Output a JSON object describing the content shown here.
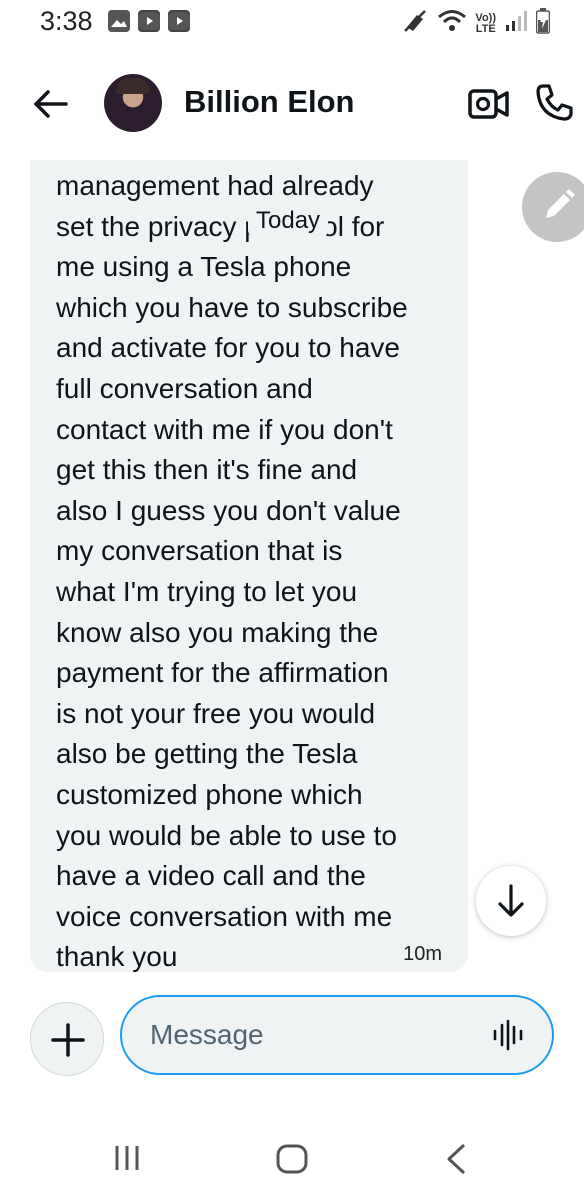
{
  "status_bar": {
    "time": "3:38",
    "left_icons": [
      "gallery-icon",
      "youtube-icon",
      "youtube-icon"
    ],
    "right_icons": [
      "no-sound-icon",
      "wifi-icon",
      "volte-icon",
      "signal-icon",
      "battery-icon"
    ],
    "volte_top": "Vo))",
    "volte_bottom": "LTE"
  },
  "header": {
    "back_icon": "arrow-left-icon",
    "contact_name": "Billion Elon",
    "video_icon": "video-camera-icon",
    "call_icon": "phone-icon"
  },
  "conversation": {
    "date_divider": "Today",
    "message": {
      "text": "management had already\nset the privacy protocol for\nme using a Tesla phone\nwhich you have to subscribe\nand activate for you to have\nfull conversation and\ncontact with me if you don't\nget this then it's fine and\nalso I guess you don't value\nmy conversation that is\nwhat I'm trying to let you\nknow also you making the\npayment for the affirmation\nis not your free you would\nalso be getting the Tesla\ncustomized phone which\nyou would be able to use to\nhave a video call and the\nvoice conversation with me\nthank you",
      "time": "10m"
    }
  },
  "composer": {
    "placeholder": "Message",
    "add_icon": "plus-icon",
    "voice_icon": "voice-waveform-icon"
  },
  "fabs": {
    "edit_icon": "pencil-icon",
    "scroll_icon": "arrow-down-icon"
  },
  "nav_bar": {
    "icons": [
      "recents-icon",
      "home-icon",
      "back-icon"
    ]
  },
  "colors": {
    "accent": "#1d9bf0",
    "bubble": "#eff3f4",
    "text": "#0f1419",
    "fab_gray": "#c4c4c4"
  }
}
